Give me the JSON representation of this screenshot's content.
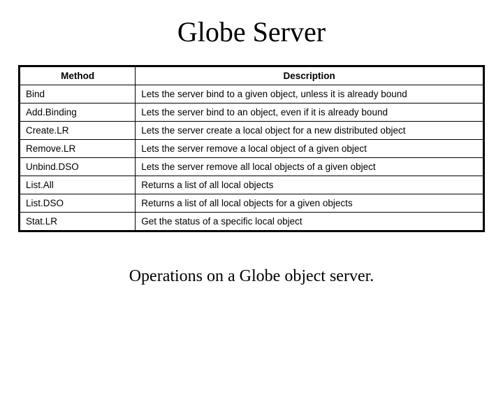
{
  "title": "Globe Server",
  "table": {
    "headers": {
      "method": "Method",
      "description": "Description"
    },
    "rows": [
      {
        "method": "Bind",
        "description": "Lets the server bind to a given object, unless it is already bound"
      },
      {
        "method": "Add.Binding",
        "description": "Lets the server bind to an object, even if it is already bound"
      },
      {
        "method": "Create.LR",
        "description": "Lets the server create a local object for a new distributed object"
      },
      {
        "method": "Remove.LR",
        "description": "Lets the server remove a local object of a given object"
      },
      {
        "method": "Unbind.DSO",
        "description": "Lets the server remove all local objects of a given object"
      },
      {
        "method": "List.All",
        "description": "Returns a list of all local objects"
      },
      {
        "method": "List.DSO",
        "description": "Returns a list of all local objects for a given objects"
      },
      {
        "method": "Stat.LR",
        "description": "Get the status of a specific local object"
      }
    ]
  },
  "caption": "Operations on a Globe object server."
}
